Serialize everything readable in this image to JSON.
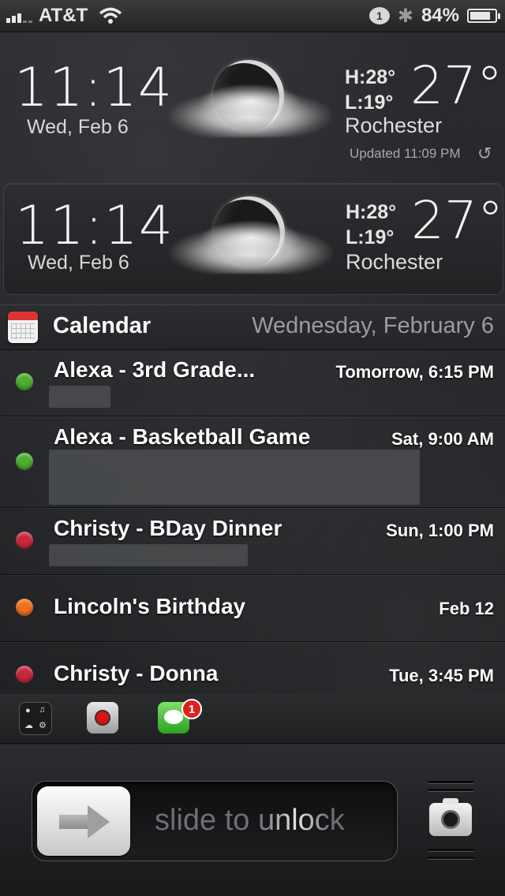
{
  "status_bar": {
    "carrier": "AT&T",
    "notification_count": "1",
    "battery_percent": "84%",
    "battery_level": 0.84,
    "icons": [
      "signal-icon",
      "wifi-icon",
      "notification-bubble-icon",
      "bluetooth-icon",
      "battery-icon"
    ]
  },
  "weather_widgets": [
    {
      "time": "11:14",
      "date": "Wed, Feb 6",
      "high": "H:28°",
      "low": "L:19°",
      "temp": "27°",
      "city": "Rochester",
      "updated": "Updated 11:09 PM",
      "condition_icon": "moon-cloud-icon"
    },
    {
      "time": "11:14",
      "date": "Wed, Feb 6",
      "high": "H:28°",
      "low": "L:19°",
      "temp": "27°",
      "city": "Rochester",
      "condition_icon": "moon-cloud-icon"
    }
  ],
  "calendar": {
    "title": "Calendar",
    "date": "Wednesday, February 6",
    "events": [
      {
        "title": "Alexa - 3rd Grade...",
        "time": "Tomorrow, 6:15 PM",
        "color": "#4caf2f"
      },
      {
        "title": "Alexa - Basketball Game",
        "time": "Sat, 9:00 AM",
        "color": "#4caf2f"
      },
      {
        "title": "Christy - BDay Dinner",
        "time": "Sun, 1:00 PM",
        "color": "#c8283c"
      },
      {
        "title": "Lincoln's Birthday",
        "time": "Feb 12",
        "color": "#f0701e"
      },
      {
        "title": "Christy - Donna",
        "time": "Tue, 3:45 PM",
        "color": "#c8283c"
      }
    ]
  },
  "dock": {
    "apps": [
      "lockinfo-app-icon",
      "record-app-icon",
      "messages-app-icon"
    ],
    "messages_badge": "1"
  },
  "lock": {
    "slide_text": "slide to unlock",
    "camera_icon": "camera-icon"
  }
}
